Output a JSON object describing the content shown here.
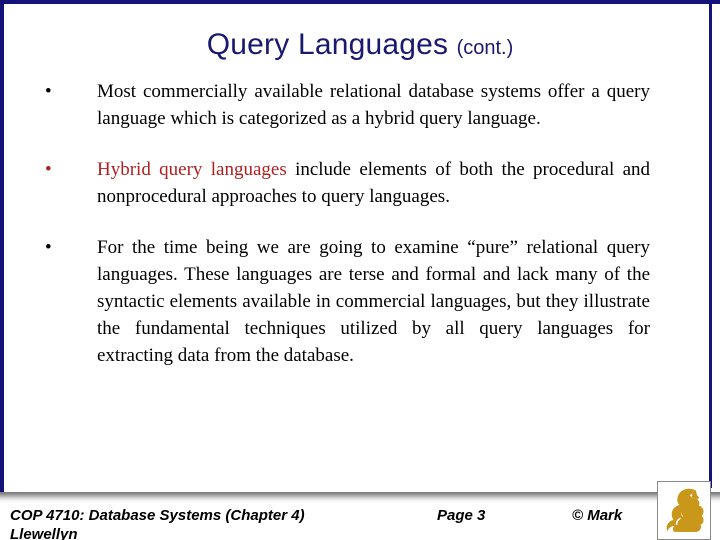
{
  "slide": {
    "title_main": "Query Languages",
    "title_sub": "(cont.)",
    "accent_navy": "#191970",
    "accent_red": "#b02020",
    "logo_gold": "#c9971a"
  },
  "bullets": [
    {
      "marker": "•",
      "marker_color": "black",
      "text": "Most commercially available relational database systems offer a query language which is categorized as a hybrid query language."
    },
    {
      "marker": "•",
      "marker_color": "red",
      "highlight": "Hybrid query languages",
      "text_rest": " include elements of both the procedural and nonprocedural approaches to query languages."
    },
    {
      "marker": "•",
      "marker_color": "black",
      "text": "For the time being we are going to examine “pure” relational query languages.  These languages are terse and formal and lack many of the syntactic elements available in commercial languages, but they illustrate the fundamental techniques utilized by all query languages for extracting data from the database."
    }
  ],
  "footer": {
    "course": "COP 4710: Database Systems  (Chapter 4)",
    "author": "Llewellyn",
    "page": "Page 3",
    "copyright": "© Mark",
    "logo_name": "ucf-pegasus-logo"
  }
}
